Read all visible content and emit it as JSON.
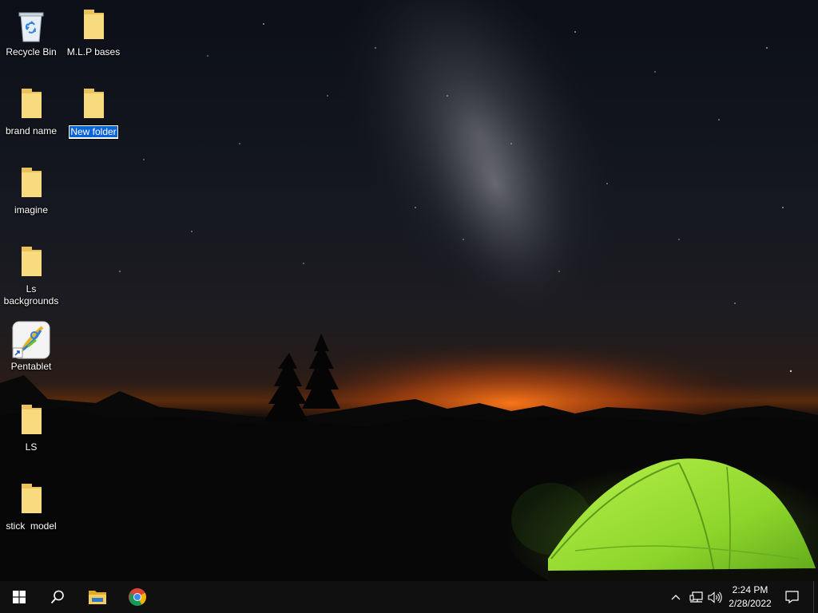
{
  "desktop": {
    "icons": [
      {
        "label": "Recycle Bin",
        "icon": "recycle-bin-icon"
      },
      {
        "label": "M.L.P bases",
        "icon": "folder-icon"
      },
      {
        "label": "brand name",
        "icon": "folder-icon"
      },
      {
        "label": "New folder",
        "icon": "folder-icon",
        "state": "renaming"
      },
      {
        "label": "imagine",
        "icon": "folder-icon"
      },
      {
        "label": "Ls backgrounds",
        "icon": "folder-icon"
      },
      {
        "label": "Pentablet",
        "icon": "pentablet-shortcut-icon"
      },
      {
        "label": "LS",
        "icon": "folder-icon"
      },
      {
        "label": "stick  model",
        "icon": "folder-icon"
      }
    ]
  },
  "taskbar": {
    "pinned": [
      {
        "name": "start",
        "icon": "windows-logo-icon"
      },
      {
        "name": "search",
        "icon": "search-icon"
      },
      {
        "name": "file-explorer",
        "icon": "file-explorer-icon"
      },
      {
        "name": "chrome",
        "icon": "chrome-icon"
      }
    ],
    "tray": {
      "icons": [
        "chevron-up-icon",
        "network-icon",
        "volume-icon"
      ],
      "time": "2:24 PM",
      "date": "2/28/2022",
      "notification_icon": "action-center-icon"
    }
  },
  "colors": {
    "taskbar_bg": "#101010",
    "folder_yellow": "#f6d77a",
    "selection_blue": "#0a64d6",
    "tent_green": "#9be33b"
  }
}
